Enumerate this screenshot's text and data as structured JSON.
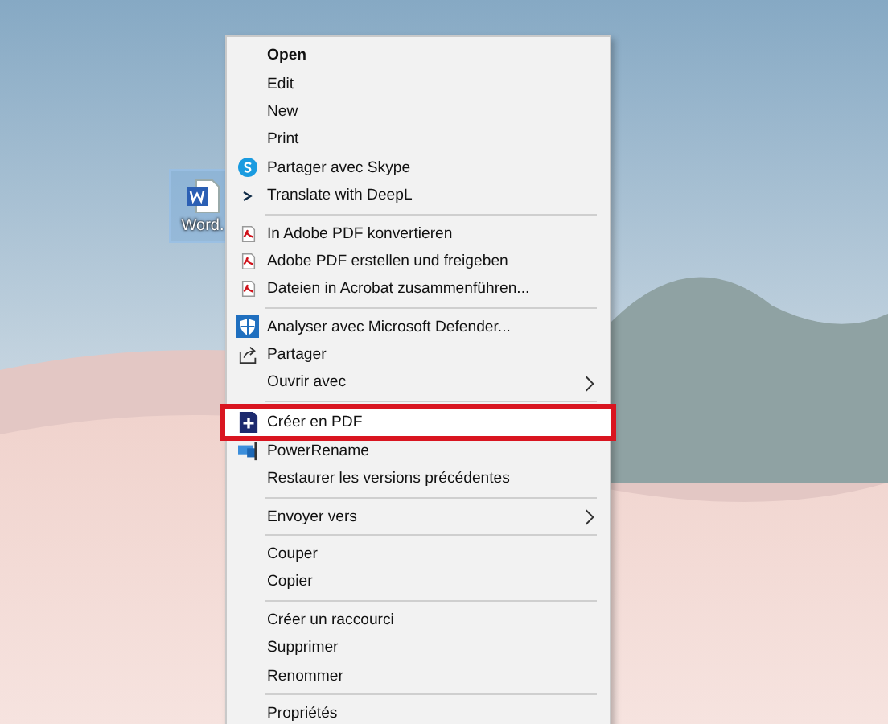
{
  "desktop": {
    "icon": {
      "label": "Word.",
      "selected": true
    }
  },
  "menu": {
    "groups": [
      [
        {
          "label": "Open",
          "kind": "none",
          "default": true,
          "submenu": false,
          "highlighted": false
        },
        {
          "label": "Edit",
          "kind": "none",
          "default": false,
          "submenu": false,
          "highlighted": false
        },
        {
          "label": "New",
          "kind": "none",
          "default": false,
          "submenu": false,
          "highlighted": false
        },
        {
          "label": "Print",
          "kind": "none",
          "default": false,
          "submenu": false,
          "highlighted": false
        },
        {
          "label": "Partager avec Skype",
          "kind": "skype",
          "default": false,
          "submenu": false,
          "highlighted": false
        },
        {
          "label": "Translate with DeepL",
          "kind": "deepl",
          "default": false,
          "submenu": false,
          "highlighted": false
        }
      ],
      [
        {
          "label": "In Adobe PDF konvertieren",
          "kind": "adobe",
          "default": false,
          "submenu": false,
          "highlighted": false
        },
        {
          "label": "Adobe PDF erstellen und freigeben",
          "kind": "adobe",
          "default": false,
          "submenu": false,
          "highlighted": false
        },
        {
          "label": "Dateien in Acrobat zusammenführen...",
          "kind": "adobe",
          "default": false,
          "submenu": false,
          "highlighted": false
        }
      ],
      [
        {
          "label": "Analyser avec Microsoft Defender...",
          "kind": "defender",
          "default": false,
          "submenu": false,
          "highlighted": false
        },
        {
          "label": "Partager",
          "kind": "share",
          "default": false,
          "submenu": false,
          "highlighted": false
        },
        {
          "label": "Ouvrir avec",
          "kind": "none",
          "default": false,
          "submenu": true,
          "highlighted": false
        }
      ],
      [
        {
          "label": "Créer en PDF",
          "kind": "pdfplus",
          "default": false,
          "submenu": false,
          "highlighted": true
        },
        {
          "label": "PowerRename",
          "kind": "rename",
          "default": false,
          "submenu": false,
          "highlighted": false
        },
        {
          "label": "Restaurer les versions précédentes",
          "kind": "none",
          "default": false,
          "submenu": false,
          "highlighted": false
        }
      ],
      [
        {
          "label": "Envoyer vers",
          "kind": "none",
          "default": false,
          "submenu": true,
          "highlighted": false
        }
      ],
      [
        {
          "label": "Couper",
          "kind": "none",
          "default": false,
          "submenu": false,
          "highlighted": false
        },
        {
          "label": "Copier",
          "kind": "none",
          "default": false,
          "submenu": false,
          "highlighted": false
        }
      ],
      [
        {
          "label": "Créer un raccourci",
          "kind": "none",
          "default": false,
          "submenu": false,
          "highlighted": false
        },
        {
          "label": "Supprimer",
          "kind": "none",
          "default": false,
          "submenu": false,
          "highlighted": false
        },
        {
          "label": "Renommer",
          "kind": "none",
          "default": false,
          "submenu": false,
          "highlighted": false
        }
      ],
      [
        {
          "label": "Propriétés",
          "kind": "none",
          "default": false,
          "submenu": false,
          "highlighted": false
        }
      ]
    ]
  }
}
